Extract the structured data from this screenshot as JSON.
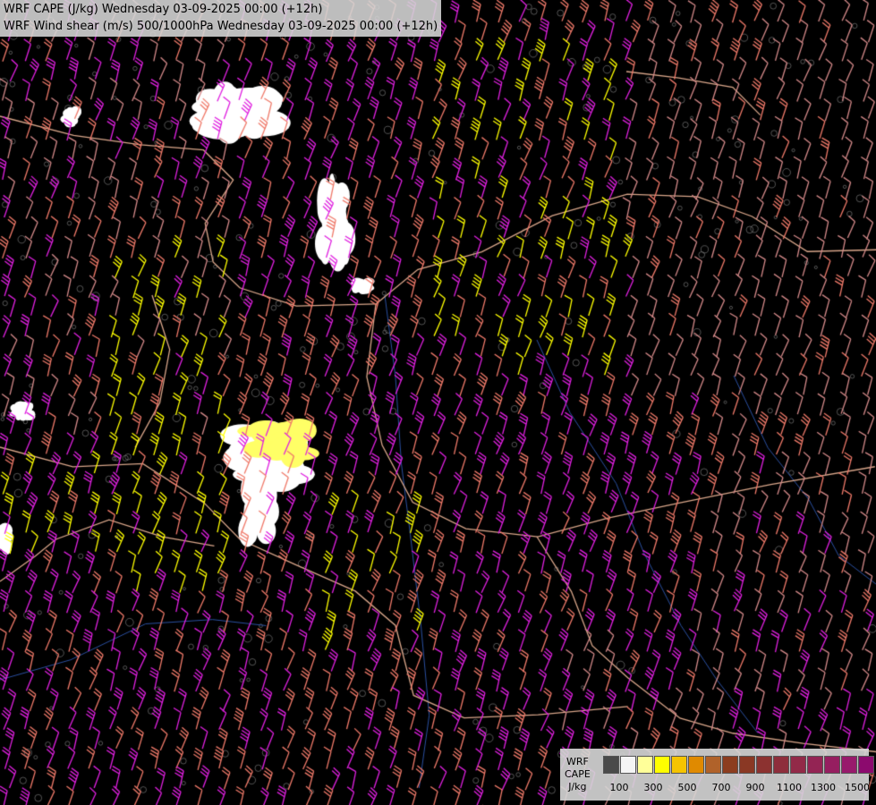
{
  "header": {
    "line1": "WRF CAPE (J/kg) Wednesday 03-09-2025 00:00 (+12h)",
    "line2": "WRF Wind shear (m/s) 500/1000hPa Wednesday 03-09-2025 00:00 (+12h)"
  },
  "legend": {
    "title_lines": [
      "WRF",
      "CAPE",
      "J/kg"
    ],
    "swatch_colors": [
      "#4a4a4a",
      "#f5f5f5",
      "#ffff99",
      "#ffff00",
      "#f5c400",
      "#e08a00",
      "#b0622a",
      "#8c3d1f",
      "#8a3824",
      "#8c3230",
      "#8e2e3c",
      "#922a48",
      "#942454",
      "#961e60",
      "#981a6c",
      "#8c0a6e"
    ],
    "tick_labels": [
      "100",
      "300",
      "500",
      "700",
      "900",
      "1100",
      "1300",
      "1500"
    ]
  },
  "colors": {
    "background": "#000000",
    "barb_magenta": "#e020e0",
    "barb_salmon": "#f07a6a",
    "barb_yellow": "#ffff00",
    "barb_pink": "#d58a8a",
    "border_line": "#d9a68a",
    "river_line": "#2a4fa0",
    "contour_gray": "#8a8a8a"
  },
  "icons": [
    "wind-barb-icon"
  ]
}
